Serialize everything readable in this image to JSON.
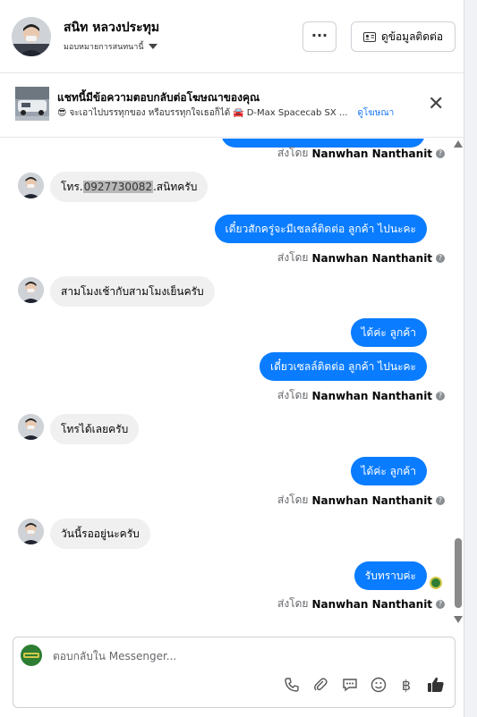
{
  "header": {
    "name": "สนิท หลวงประทุม",
    "assign_label": "มอบหมายการสนทนานี้",
    "more_label": "···",
    "contact_button": "ดูข้อมูลติดต่อ"
  },
  "ad": {
    "title": "แชทนี้มีข้อความตอบกลับต่อโฆษณาของคุณ",
    "subtitle": "จะเอาไปบรรทุกของ หรือบรรทุกใจเธอก็ได้",
    "vehicle": "D-Max Spacecab SX ...",
    "link": "ดูโฆษณา",
    "close_label": "✕"
  },
  "sender_prefix": "ส่งโดย",
  "sender_name": "Nanwhan Nanthanit",
  "messages": {
    "m1_pre": "โทร.",
    "m1_phone": "0927730082",
    "m1_post": ".สนิทครับ",
    "m2": "เดี๋ยวสักครู่จะมีเซลล์ติดต่อ ลูกค้า ไปนะคะ",
    "m3": "สามโมงเช้ากับสามโมงเย็นครับ",
    "m4": "ได้ค่ะ  ลูกค้า",
    "m5": "เดี๋ยวเซลล์ติดต่อ ลูกค้า ไปนะคะ",
    "m6": "โทรได้เลยครับ",
    "m7": "ได้ค่ะ  ลูกค้า",
    "m8": "วันนี้รออยู่นะครับ",
    "m9": "รับทราบค่ะ"
  },
  "composer": {
    "placeholder": "ตอบกลับใน Messenger..."
  },
  "icons": {
    "call": "phone-icon",
    "attach": "paperclip-icon",
    "saved_replies": "chat-bubble-icon",
    "emoji": "emoji-icon",
    "payment": "baht-icon",
    "like": "thumbs-up-icon"
  },
  "colors": {
    "outgoing_bubble": "#0a7cff",
    "incoming_bubble": "#f0f0f0",
    "link": "#1877f2"
  }
}
